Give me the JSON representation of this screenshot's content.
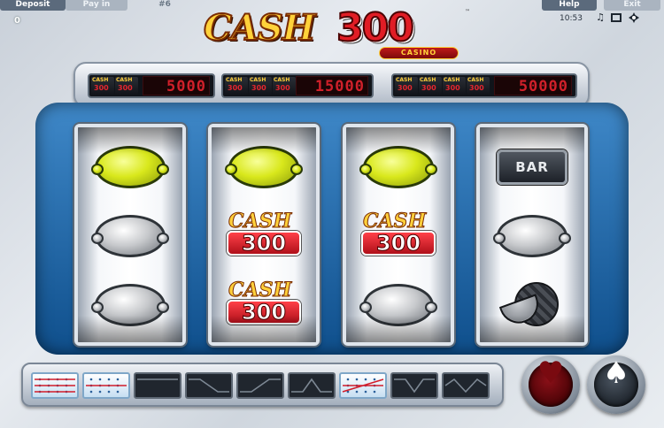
{
  "topbar": {
    "deposit_label": "Deposit",
    "payin_label": "Pay in",
    "game_number": "#6",
    "help_label": "Help",
    "exit_label": "Exit",
    "balance": "0",
    "clock": "10:53"
  },
  "system_icons": [
    "music-note-icon",
    "fullscreen-icon",
    "settings-icon"
  ],
  "logo": {
    "word": "CASH",
    "number": "300",
    "casino": "CASINO",
    "tm": "™"
  },
  "jackpots": [
    {
      "symbols": 2,
      "value": "5000"
    },
    {
      "symbols": 3,
      "value": "15000"
    },
    {
      "symbols": 4,
      "value": "50000"
    }
  ],
  "cash_symbol": {
    "word": "CASH",
    "number": "300"
  },
  "bar_symbol": "BAR",
  "reels": [
    [
      "lemon-yellow",
      "lemon-grey",
      "lemon-grey"
    ],
    [
      "lemon-yellow",
      "cash300",
      "cash300"
    ],
    [
      "lemon-yellow",
      "cash300",
      "lemon-grey"
    ],
    [
      "bar",
      "lemon-grey",
      "melon-grey"
    ]
  ],
  "paylines": [
    {
      "on": true,
      "shape": "rows"
    },
    {
      "on": true,
      "shape": "middle"
    },
    {
      "on": false,
      "shape": "top-flat"
    },
    {
      "on": false,
      "shape": "down"
    },
    {
      "on": false,
      "shape": "up"
    },
    {
      "on": false,
      "shape": "hump"
    },
    {
      "on": true,
      "shape": "cross"
    },
    {
      "on": false,
      "shape": "valley"
    },
    {
      "on": false,
      "shape": "zigzag"
    }
  ],
  "buttons": {
    "gamble_glyph": "♥",
    "start_glyph": "♠"
  },
  "colors": {
    "frame": "#1a5f9e",
    "jackpot_red": "#d0202a",
    "lemon": "#d9e81c"
  }
}
